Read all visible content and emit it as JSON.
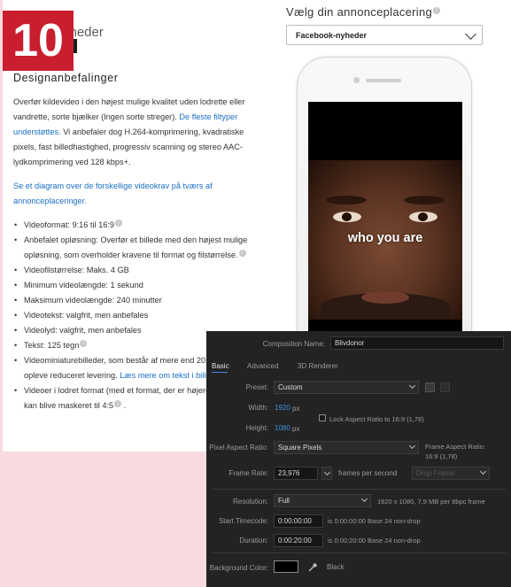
{
  "badge": {
    "number": "10"
  },
  "page": {
    "subtitle_fragment": "yheder",
    "section_title": "Designanbefalinger",
    "intro_text": "Overfør kildevideo i den højest mulige kvalitet uden lodrette eller vandrette, sorte bjælker (Ingen sorte streger).",
    "intro_link": "De fleste filtyper understøttes.",
    "intro_text_2": "Vi anbefaler dog H.264-komprimering, kvadratiske pixels, fast billedhastighed, progressiv scanning og stereo AAC-lydkomprimering ved 128 kbps+.",
    "diagram_link": "Se et diagram over de forskellige videokrav på tværs af annonceplaceringer.",
    "bullets": [
      {
        "text": "Videoformat: 9:16 til 16:9",
        "info": true
      },
      {
        "text": "Anbefalet opløsning: Overfør et billede med den højest mulige opløsning, som overholder kravene til format og filstørrelse.",
        "info": true
      },
      {
        "text": "Videofilstørrelse: Maks. 4 GB"
      },
      {
        "text": "Minimum videolængde: 1 sekund"
      },
      {
        "text": "Maksimum videolængde: 240 minutter"
      },
      {
        "text": "Videotekst: valgfrit, men anbefales"
      },
      {
        "text": "Videolyd: valgfrit, men anbefales"
      },
      {
        "text": "Tekst: 125 tegn",
        "info": true
      },
      {
        "text": "Videominiaturebilleder, som består af mere end 20 % tekst, kan opleve reduceret levering.",
        "link": "Læs mere om tekst i billeder."
      },
      {
        "text": "Videoer i lodret format (med et format, der er højere end 4:5) kan blive maskeret til 4:5",
        "info": true,
        "suffix": " ."
      }
    ]
  },
  "placement": {
    "label": "Vælg din annonceplacering",
    "selected": "Facebook-nyheder"
  },
  "preview": {
    "caption": "who you are"
  },
  "ae": {
    "comp_name_label": "Composition Name:",
    "comp_name": "Blivdonor",
    "tabs": [
      "Basic",
      "Advanced",
      "3D Renderer"
    ],
    "preset_label": "Preset:",
    "preset": "Custom",
    "width_label": "Width:",
    "width": "1920",
    "height_label": "Height:",
    "height": "1080",
    "px": "px",
    "lock_label": "Lock Aspect Ratio to 16:9 (1,78)",
    "par_label": "Pixel Aspect Ratio:",
    "par": "Square Pixels",
    "far_label": "Frame Aspect Ratio:",
    "far_value": "16:9 (1,78)",
    "fps_label": "Frame Rate:",
    "fps": "23,976",
    "fps_unit": "frames per second",
    "drop_frame": "Drop Frame",
    "res_label": "Resolution:",
    "res": "Full",
    "res_info": "1920 x 1080, 7,9 MB per 8bpc frame",
    "start_label": "Start Timecode:",
    "start": "0:00:00:00",
    "start_info": "is 0:00:00:00  Base 24  non-drop",
    "dur_label": "Duration:",
    "dur": "0:00:20:00",
    "dur_info": "is 0:00:20:00  Base 24  non-drop",
    "bg_label": "Background Color:",
    "bg_name": "Black"
  }
}
